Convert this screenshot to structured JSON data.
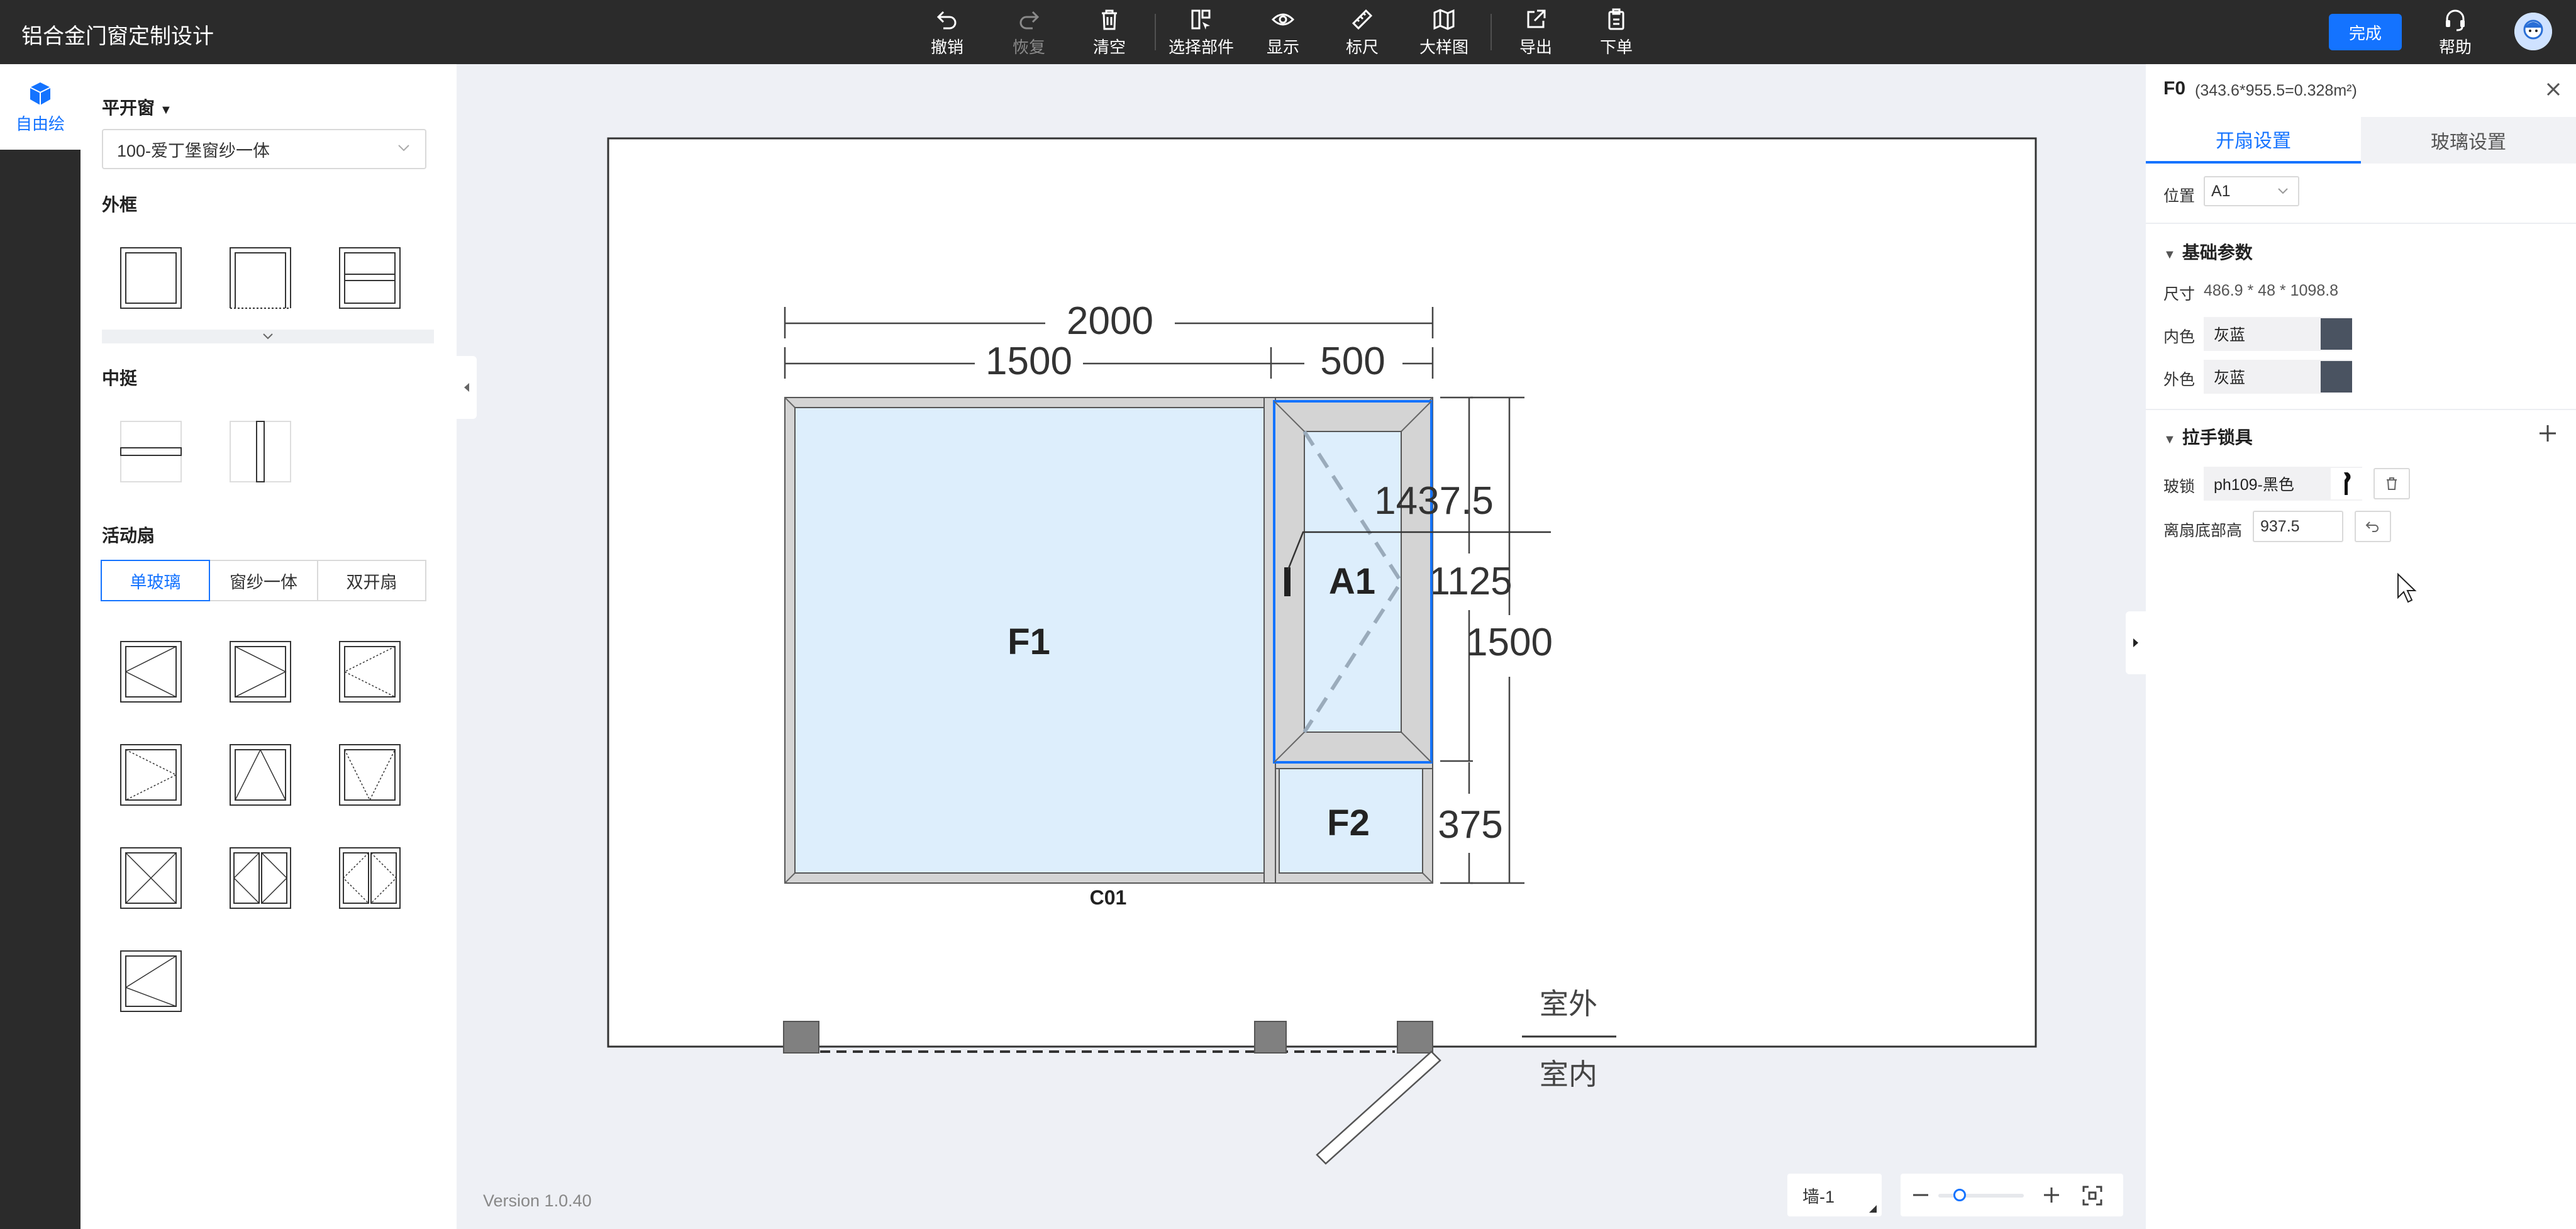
{
  "app": {
    "title": "铝合金门窗定制设计"
  },
  "toolbar": {
    "undo": "撤销",
    "redo": "恢复",
    "clear": "清空",
    "select_parts": "选择部件",
    "display": "显示",
    "ruler": "标尺",
    "detail_drawing": "大样图",
    "export": "导出",
    "order": "下单",
    "finish": "完成",
    "help": "帮助"
  },
  "rail": {
    "free_draw": "自由绘"
  },
  "components": {
    "window_type": "平开窗",
    "series_value": "100-爱丁堡窗纱一体",
    "outer_frame_title": "外框",
    "mullion_title": "中挺",
    "sash_title": "活动扇",
    "sash_tabs": [
      "单玻璃",
      "窗纱一体",
      "双开扇"
    ]
  },
  "drawing": {
    "dims_top": {
      "total": "2000",
      "left": "1500",
      "right": "500"
    },
    "dims_right": {
      "a1": "1125",
      "total": "1500",
      "f2": "375"
    },
    "handle_height": "1437.5",
    "panes": {
      "f1": "F1",
      "a1": "A1",
      "f2": "F2"
    },
    "code": "C01",
    "outside": "室外",
    "inside": "室内"
  },
  "canvas": {
    "version": "Version 1.0.40",
    "wall": "墙-1"
  },
  "props": {
    "title": "F0",
    "size": "(343.6*955.5=0.328m²)",
    "tabs": [
      "开扇设置",
      "玻璃设置"
    ],
    "position_label": "位置",
    "position_value": "A1",
    "basic_title": "基础参数",
    "dimension_label": "尺寸",
    "dimension_value": "486.9 * 48 * 1098.8",
    "inner_color_label": "内色",
    "inner_color_value": "灰蓝",
    "outer_color_label": "外色",
    "outer_color_value": "灰蓝",
    "hardware_title": "拉手锁具",
    "lock_label": "玻锁",
    "lock_value": "ph109-黑色",
    "height_label": "离扇底部高",
    "height_value": "937.5"
  },
  "colors": {
    "accent": "#1473ff",
    "swatch": "#4a5361",
    "glass": "#ddeefc",
    "frame": "#d4d4d4",
    "topbar": "#2b2b2b"
  }
}
